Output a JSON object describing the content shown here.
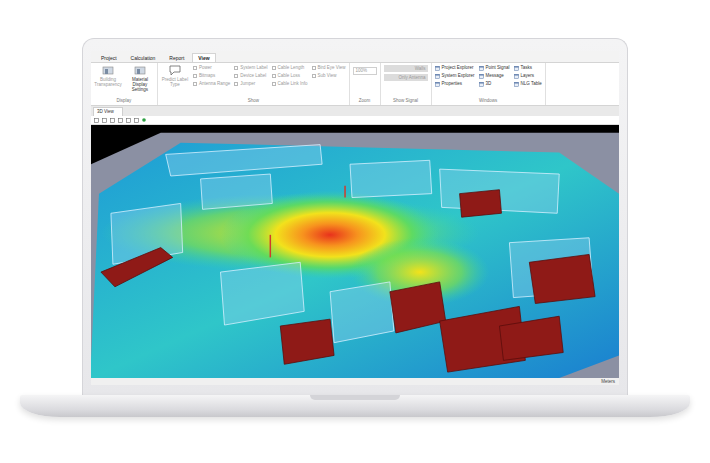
{
  "menu": [
    {
      "label": "Project",
      "selected": false
    },
    {
      "label": "Calculation",
      "selected": false
    },
    {
      "label": "Report",
      "selected": false
    },
    {
      "label": "View",
      "selected": true
    }
  ],
  "ribbon": {
    "groups": [
      {
        "label": "Display",
        "items": [
          {
            "label": "Building Transparency",
            "kind": "big",
            "disabled": true
          },
          {
            "label": "Material Display Settings",
            "kind": "big",
            "disabled": false
          }
        ]
      },
      {
        "label": "Show",
        "items": [
          {
            "label": "Predict Label Type",
            "kind": "big",
            "disabled": true
          },
          {
            "label": "Power",
            "kind": "check",
            "checked": false,
            "disabled": true
          },
          {
            "label": "Bitmaps",
            "kind": "check",
            "checked": false,
            "disabled": true
          },
          {
            "label": "Antenna Range",
            "kind": "check",
            "checked": false,
            "disabled": true
          },
          {
            "label": "System Label",
            "kind": "check",
            "checked": false,
            "disabled": true
          },
          {
            "label": "Device Label",
            "kind": "check",
            "checked": false,
            "disabled": true
          },
          {
            "label": "Jumper",
            "kind": "check",
            "checked": false,
            "disabled": true
          },
          {
            "label": "Cable Length",
            "kind": "check",
            "checked": false,
            "disabled": true
          },
          {
            "label": "Cable Loss",
            "kind": "check",
            "checked": false,
            "disabled": true
          },
          {
            "label": "Cable Link Info",
            "kind": "check",
            "checked": false,
            "disabled": true
          },
          {
            "label": "Bird Eye View",
            "kind": "check",
            "checked": false,
            "disabled": true
          },
          {
            "label": "Sub View",
            "kind": "check",
            "checked": false,
            "disabled": true
          }
        ]
      },
      {
        "label": "Zoom",
        "items": [
          {
            "label": "100%",
            "kind": "field",
            "disabled": true
          }
        ]
      },
      {
        "label": "Show Signal",
        "items": [
          {
            "label": "Walls",
            "kind": "button",
            "disabled": true
          },
          {
            "label": "Only Antenna",
            "kind": "button",
            "disabled": true
          }
        ]
      },
      {
        "label": "Windows",
        "items": [
          {
            "label": "Project Explorer",
            "kind": "window",
            "disabled": false
          },
          {
            "label": "System Explorer",
            "kind": "window",
            "disabled": false
          },
          {
            "label": "Properties",
            "kind": "window",
            "disabled": false
          },
          {
            "label": "Point Signal",
            "kind": "window",
            "disabled": false
          },
          {
            "label": "Message",
            "kind": "window",
            "disabled": false
          },
          {
            "label": "3D",
            "kind": "window",
            "disabled": false
          },
          {
            "label": "Tasks",
            "kind": "window",
            "disabled": false
          },
          {
            "label": "Layers",
            "kind": "window",
            "disabled": false
          },
          {
            "label": "NLG Table",
            "kind": "window",
            "disabled": false
          }
        ]
      }
    ]
  },
  "document_tab": {
    "label": "3D View",
    "selected": true
  },
  "status_bar": {
    "units": "Meters"
  }
}
